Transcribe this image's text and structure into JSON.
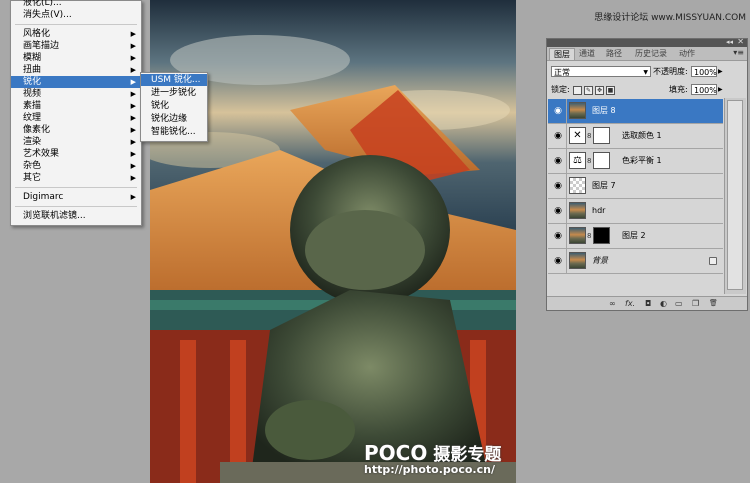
{
  "site_watermark": "思缘设计论坛 www.MISSYUAN.COM",
  "filter_menu": {
    "top_items": [
      "液化(L)...",
      "消失点(V)..."
    ],
    "items": [
      {
        "label": "风格化",
        "arrow": "▶"
      },
      {
        "label": "画笔描边",
        "arrow": "▶"
      },
      {
        "label": "模糊",
        "arrow": "▶"
      },
      {
        "label": "扭曲",
        "arrow": "▶"
      },
      {
        "label": "锐化",
        "arrow": "▶"
      },
      {
        "label": "视频",
        "arrow": "▶"
      },
      {
        "label": "素描",
        "arrow": "▶"
      },
      {
        "label": "纹理",
        "arrow": "▶"
      },
      {
        "label": "像素化",
        "arrow": "▶"
      },
      {
        "label": "渲染",
        "arrow": "▶"
      },
      {
        "label": "艺术效果",
        "arrow": "▶"
      },
      {
        "label": "杂色",
        "arrow": "▶"
      },
      {
        "label": "其它",
        "arrow": "▶"
      }
    ],
    "digimarc": {
      "label": "Digimarc",
      "arrow": "▶"
    },
    "browse": "浏览联机滤镜..."
  },
  "sharpen_submenu": [
    "USM 锐化...",
    "进一步锐化",
    "锐化",
    "锐化边缘",
    "智能锐化..."
  ],
  "layers_panel": {
    "tabs": [
      "图层",
      "通道",
      "路径",
      "历史记录",
      "动作"
    ],
    "blend_mode": "正常",
    "opacity_label": "不透明度:",
    "opacity_value": "100%",
    "lock_label": "锁定:",
    "fill_label": "填充:",
    "fill_value": "100%",
    "layers": [
      {
        "name": "图层 8",
        "selected": true
      },
      {
        "name": "选取颜色 1",
        "selected": false
      },
      {
        "name": "色彩平衡 1",
        "selected": false
      },
      {
        "name": "图层 7",
        "selected": false
      },
      {
        "name": "hdr",
        "selected": false
      },
      {
        "name": "图层 2",
        "selected": false
      },
      {
        "name": "背景",
        "selected": false
      }
    ],
    "bottom_icons": [
      "link-icon",
      "fx-icon",
      "mask-icon",
      "adjustment-icon",
      "group-icon",
      "new-layer-icon",
      "trash-icon"
    ],
    "bottom_glyphs": [
      "∞",
      "fx.",
      "◘",
      "◐",
      "▭",
      "❐",
      "🗑"
    ]
  },
  "watermark": {
    "brand": "POCO",
    "subtitle": "摄影专题",
    "url": "http://photo.poco.cn/"
  }
}
